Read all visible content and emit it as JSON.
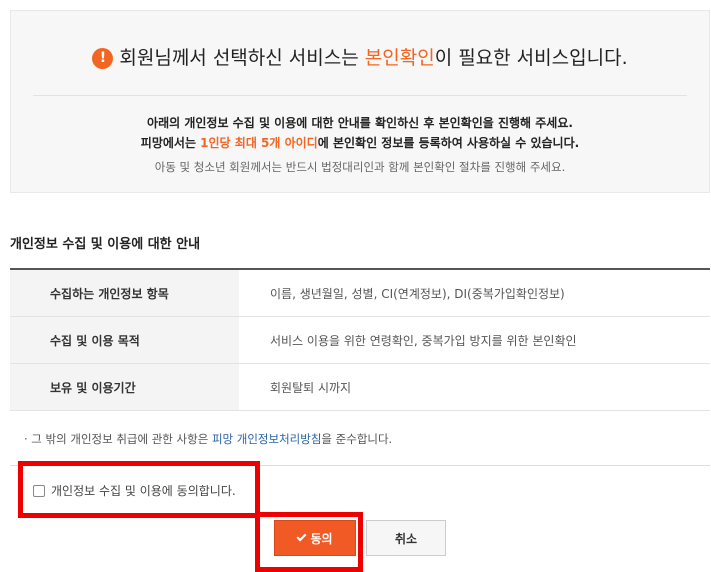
{
  "notice": {
    "icon": "alert-icon",
    "icon_glyph": "!",
    "headline_before": "회원님께서 선택하신 서비스는 ",
    "headline_accent": "본인확인",
    "headline_after": "이 필요한 서비스입니다.",
    "line1": "아래의 개인정보 수집 및 이용에 대한 안내를 확인하신 후 본인확인을 진행해 주세요.",
    "line2_before": "피망에서는 ",
    "line2_accent": "1인당 최대 5개 아이디",
    "line2_after": "에 본인확인 정보를 등록하여 사용하실 수 있습니다.",
    "line3": "아동 및 청소년 회원께서는 반드시 법정대리인과 함께 본인확인 절차를 진행해 주세요."
  },
  "privacy": {
    "title": "개인정보 수집 및 이용에 대한 안내",
    "rows": [
      {
        "label": "수집하는 개인정보 항목",
        "value": "이름, 생년월일, 성별, CI(연계정보), DI(중복가입확인정보)"
      },
      {
        "label": "수집 및 이용 목적",
        "value": "서비스 이용을 위한 연령확인, 중복가입 방지를 위한 본인확인"
      },
      {
        "label": "보유 및 이용기간",
        "value": "회원탈퇴 시까지"
      }
    ],
    "footnote_before": "· 그 밖의 개인정보 취급에 관한 사항은 ",
    "footnote_link": "피망 개인정보처리방침",
    "footnote_after": "을 준수합니다."
  },
  "consent": {
    "label": "개인정보 수집 및 이용에 동의합니다.",
    "checked": false
  },
  "buttons": {
    "agree_label": "동의",
    "cancel_label": "취소"
  },
  "colors": {
    "accent": "#f26522",
    "agree_button": "#f15a24",
    "link": "#2a63a8",
    "highlight": "#ee0000"
  }
}
